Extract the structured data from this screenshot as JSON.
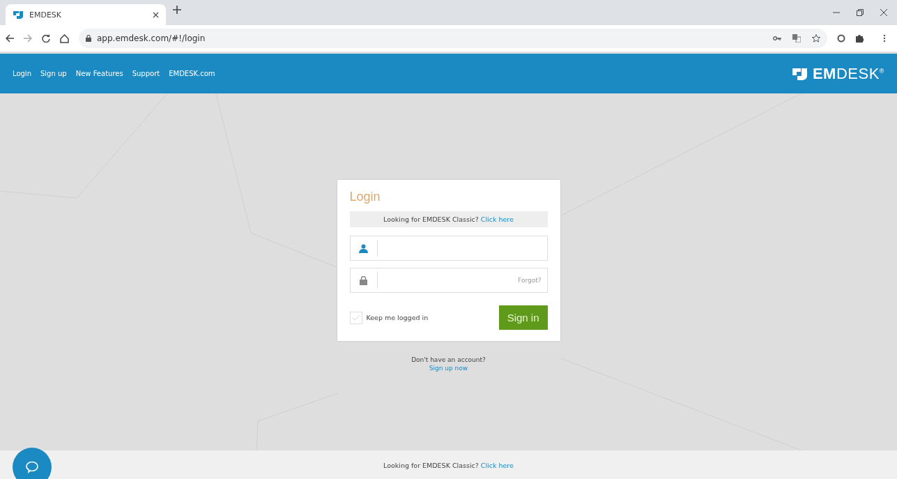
{
  "browser": {
    "tab": {
      "title": "EMDESK"
    },
    "url": "app.emdesk.com/#!/login"
  },
  "nav": {
    "links": [
      "Login",
      "Sign up",
      "New Features",
      "Support",
      "EMDESK.com"
    ],
    "logo": "**EM**DESK$^{®}$"
  },
  "login": {
    "title": "Login",
    "classic_note": "Looking for EMDESK Classic?",
    "classic_link": "Click here",
    "forgot": "Forgot?",
    "remember": {
      "label": "Keep me logged in",
      "checked": false
    },
    "submit": "Sign in"
  },
  "signup": {
    "question": "Don't have an account?",
    "link": "Sign up now"
  },
  "footer": {
    "note": "Looking for EMDESK Classic?",
    "link": "Click here"
  }
}
